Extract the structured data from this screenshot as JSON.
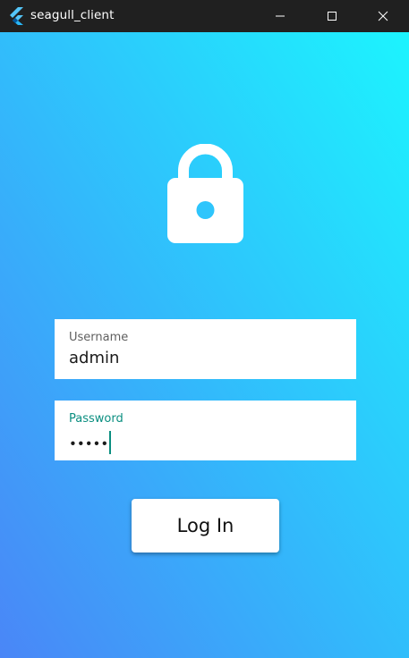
{
  "window": {
    "title": "seagull_client",
    "controls": [
      "minimize-icon",
      "maximize-icon",
      "close-icon"
    ]
  },
  "login": {
    "icon": "lock-icon",
    "username": {
      "label": "Username",
      "value": "admin"
    },
    "password": {
      "label": "Password",
      "value": "•••••"
    },
    "button_label": "Log In"
  },
  "colors": {
    "titlebar": "#202020",
    "gradient_top": "#1cf4fe",
    "gradient_bottom": "#4a86f7",
    "focus_accent": "#0b8f80"
  }
}
